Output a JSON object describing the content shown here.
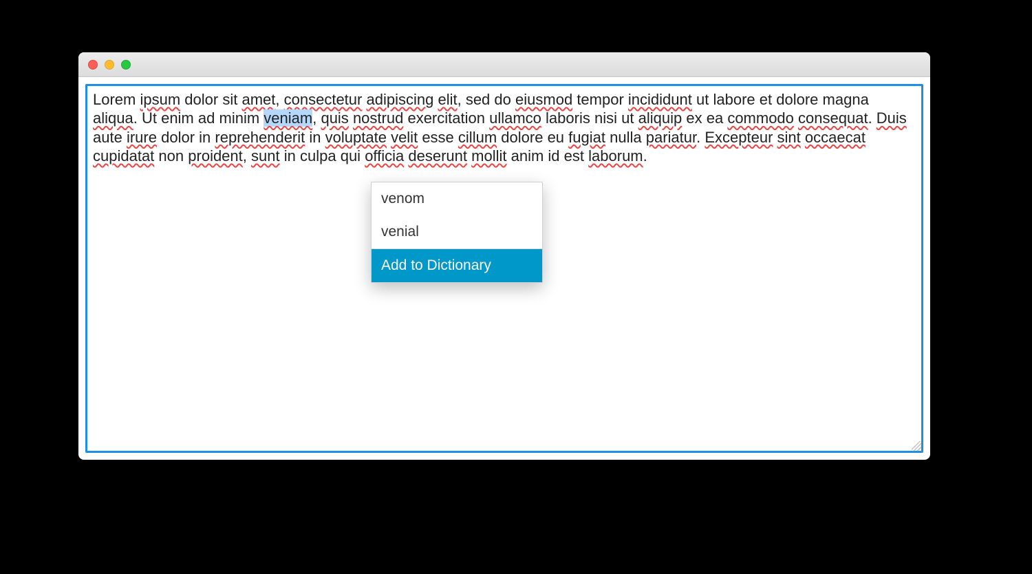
{
  "window": {
    "traffic_lights": [
      "close",
      "minimize",
      "zoom"
    ]
  },
  "editor": {
    "tokens": [
      {
        "t": "Lorem"
      },
      {
        "t": " "
      },
      {
        "t": "ipsum",
        "sp": true
      },
      {
        "t": " "
      },
      {
        "t": "dolor"
      },
      {
        "t": " "
      },
      {
        "t": "sit"
      },
      {
        "t": " "
      },
      {
        "t": "amet",
        "sp": true
      },
      {
        "t": ", "
      },
      {
        "t": "consectetur",
        "sp": true
      },
      {
        "t": " "
      },
      {
        "t": "adipiscing",
        "sp": true
      },
      {
        "t": " "
      },
      {
        "t": "elit",
        "sp": true
      },
      {
        "t": ", "
      },
      {
        "t": "sed"
      },
      {
        "t": " "
      },
      {
        "t": "do"
      },
      {
        "t": " "
      },
      {
        "t": "eiusmod",
        "sp": true
      },
      {
        "t": " "
      },
      {
        "t": "tempor"
      },
      {
        "t": " "
      },
      {
        "t": "incididunt",
        "sp": true
      },
      {
        "t": " "
      },
      {
        "t": "ut"
      },
      {
        "t": " "
      },
      {
        "t": "labore"
      },
      {
        "t": " "
      },
      {
        "t": "et"
      },
      {
        "t": " "
      },
      {
        "t": "dolore"
      },
      {
        "t": " "
      },
      {
        "t": "magna"
      },
      {
        "t": " "
      },
      {
        "t": "aliqua",
        "sp": true
      },
      {
        "t": ". "
      },
      {
        "t": "Ut"
      },
      {
        "t": " "
      },
      {
        "t": "enim"
      },
      {
        "t": " "
      },
      {
        "t": "ad"
      },
      {
        "t": " "
      },
      {
        "t": "minim"
      },
      {
        "t": " "
      },
      {
        "t": "veniam",
        "sp": true,
        "sel": true
      },
      {
        "t": ", "
      },
      {
        "t": "quis",
        "sp": true
      },
      {
        "t": " "
      },
      {
        "t": "nostrud",
        "sp": true
      },
      {
        "t": " "
      },
      {
        "t": "exercitation"
      },
      {
        "t": " "
      },
      {
        "t": "ullamco",
        "sp": true
      },
      {
        "t": " "
      },
      {
        "t": "laboris"
      },
      {
        "t": " "
      },
      {
        "t": "nisi"
      },
      {
        "t": " "
      },
      {
        "t": "ut"
      },
      {
        "t": " "
      },
      {
        "t": "aliquip",
        "sp": true
      },
      {
        "t": " "
      },
      {
        "t": "ex"
      },
      {
        "t": " "
      },
      {
        "t": "ea"
      },
      {
        "t": " "
      },
      {
        "t": "commodo",
        "sp": true
      },
      {
        "t": " "
      },
      {
        "t": "consequat",
        "sp": true
      },
      {
        "t": ". "
      },
      {
        "t": "Duis",
        "sp": true
      },
      {
        "t": " "
      },
      {
        "t": "aute"
      },
      {
        "t": " "
      },
      {
        "t": "irure",
        "sp": true
      },
      {
        "t": " "
      },
      {
        "t": "dolor"
      },
      {
        "t": " "
      },
      {
        "t": "in"
      },
      {
        "t": " "
      },
      {
        "t": "reprehenderit",
        "sp": true
      },
      {
        "t": " "
      },
      {
        "t": "in"
      },
      {
        "t": " "
      },
      {
        "t": "voluptate",
        "sp": true
      },
      {
        "t": " "
      },
      {
        "t": "velit",
        "sp": true
      },
      {
        "t": " "
      },
      {
        "t": "esse"
      },
      {
        "t": " "
      },
      {
        "t": "cillum",
        "sp": true
      },
      {
        "t": " "
      },
      {
        "t": "dolore"
      },
      {
        "t": " "
      },
      {
        "t": "eu"
      },
      {
        "t": " "
      },
      {
        "t": "fugiat",
        "sp": true
      },
      {
        "t": " "
      },
      {
        "t": "nulla"
      },
      {
        "t": " "
      },
      {
        "t": "pariatur",
        "sp": true
      },
      {
        "t": ". "
      },
      {
        "t": "Excepteur",
        "sp": true
      },
      {
        "t": " "
      },
      {
        "t": "sint",
        "sp": true
      },
      {
        "t": " "
      },
      {
        "t": "occaecat",
        "sp": true
      },
      {
        "t": " "
      },
      {
        "t": "cupidatat",
        "sp": true
      },
      {
        "t": " "
      },
      {
        "t": "non"
      },
      {
        "t": " "
      },
      {
        "t": "proident",
        "sp": true
      },
      {
        "t": ", "
      },
      {
        "t": "sunt",
        "sp": true
      },
      {
        "t": " "
      },
      {
        "t": "in"
      },
      {
        "t": " "
      },
      {
        "t": "culpa"
      },
      {
        "t": " "
      },
      {
        "t": "qui"
      },
      {
        "t": " "
      },
      {
        "t": "officia",
        "sp": true
      },
      {
        "t": " "
      },
      {
        "t": "deserunt",
        "sp": true
      },
      {
        "t": " "
      },
      {
        "t": "mollit",
        "sp": true
      },
      {
        "t": " "
      },
      {
        "t": "anim"
      },
      {
        "t": " "
      },
      {
        "t": "id"
      },
      {
        "t": " "
      },
      {
        "t": "est"
      },
      {
        "t": " "
      },
      {
        "t": "laborum",
        "sp": true
      },
      {
        "t": "."
      }
    ]
  },
  "context_menu": {
    "items": [
      {
        "label": "venom",
        "selected": false
      },
      {
        "label": "venial",
        "selected": false
      },
      {
        "label": "Add to Dictionary",
        "selected": true
      }
    ]
  }
}
